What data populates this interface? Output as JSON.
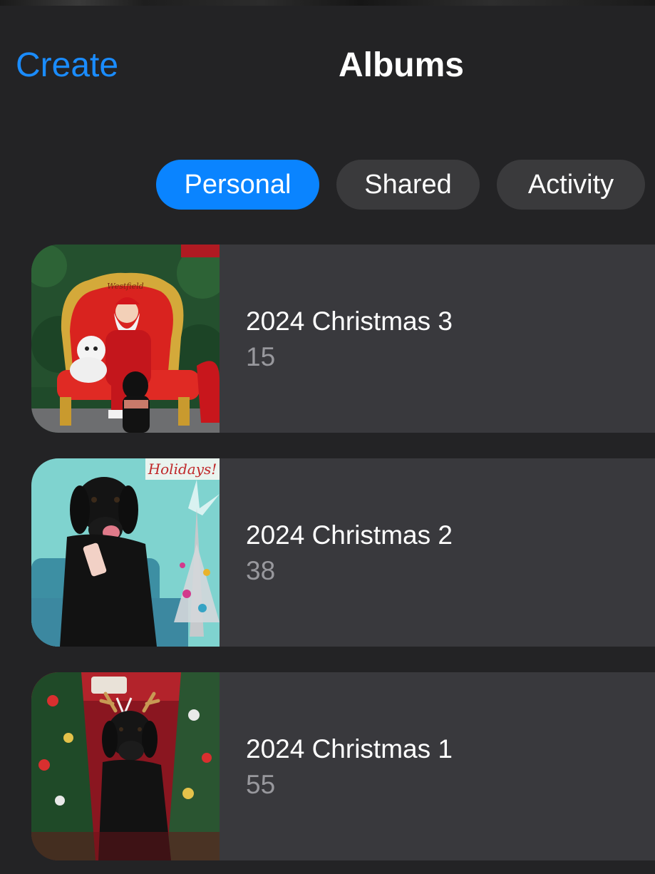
{
  "nav": {
    "create_label": "Create",
    "title": "Albums"
  },
  "segments": [
    {
      "label": "Personal",
      "selected": true
    },
    {
      "label": "Shared",
      "selected": false
    },
    {
      "label": "Activity",
      "selected": false
    }
  ],
  "albums": [
    {
      "name": "2024 Christmas 3",
      "count": "15",
      "thumbnail": "santa-chair-dogs-photo",
      "thumb_text": "Westfield"
    },
    {
      "name": "2024 Christmas 2",
      "count": "38",
      "thumbnail": "black-lab-teal-holidays-photo",
      "thumb_text": "Holidays!"
    },
    {
      "name": "2024 Christmas 1",
      "count": "55",
      "thumbnail": "black-lab-reindeer-tree-photo"
    }
  ],
  "colors": {
    "background": "#232325",
    "card": "#39393d",
    "accent": "#0a84ff",
    "link": "#1a8cff",
    "segment_inactive": "#3a3a3c",
    "secondary_text": "#98989d"
  }
}
